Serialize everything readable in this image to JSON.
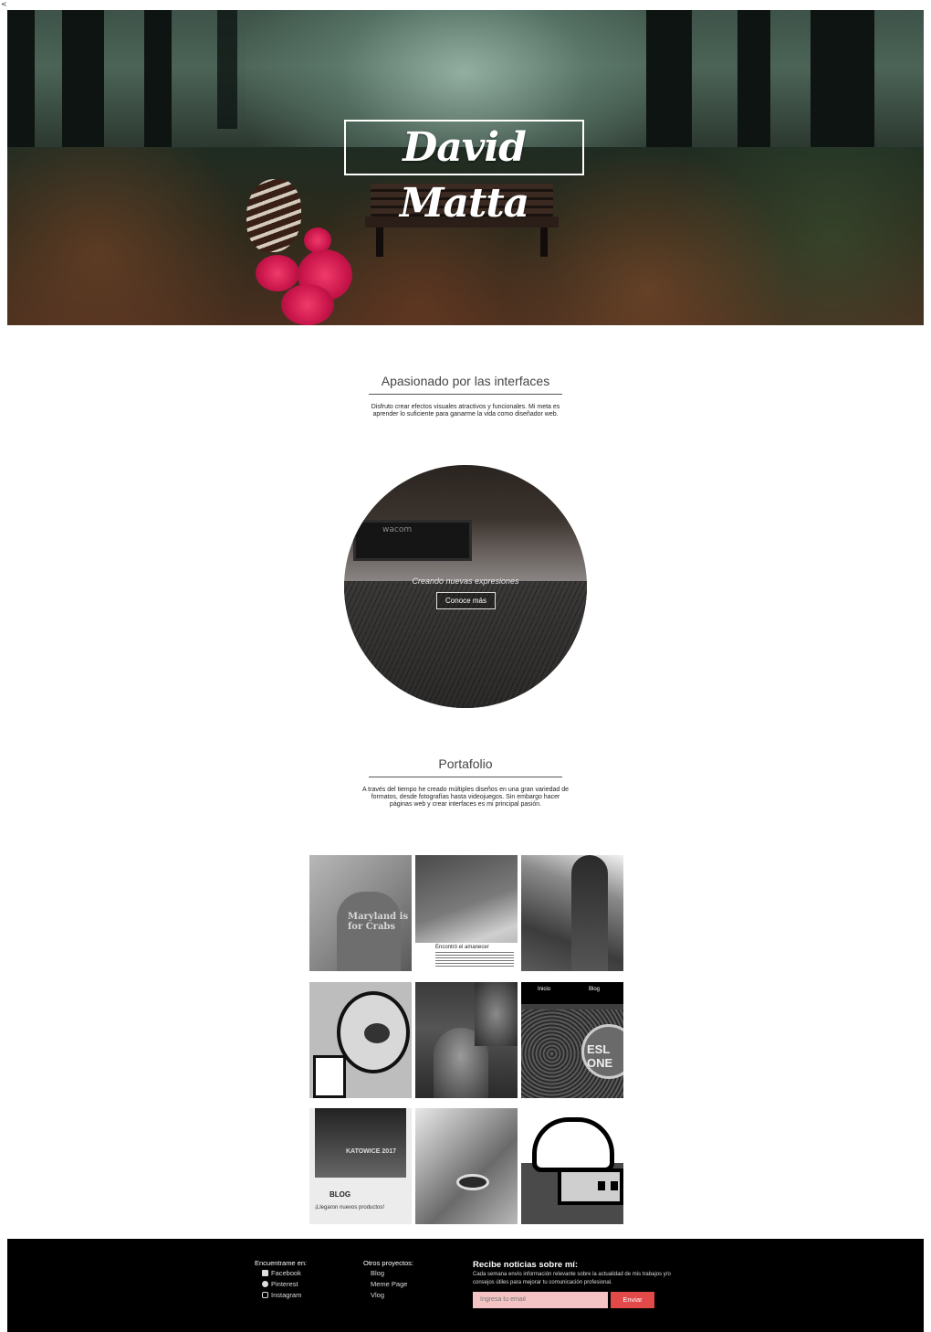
{
  "stray_char": "<",
  "hero": {
    "logo_text": "David Matta"
  },
  "about": {
    "title": "Apasionado por las interfaces",
    "body_line1": "Disfruto crear efectos visuales atractivos y funcionales. Mi meta es",
    "body_line2": "aprender lo suficiente para ganarme la vida como diseñador web."
  },
  "feature": {
    "brand": "wacom",
    "tagline": "Creando nuevas expresiones",
    "button_label": "Conoce más"
  },
  "portfolio": {
    "title": "Portafolio",
    "body_line1": "A través del tiempo he creado múltiples diseños en una gran variedad de",
    "body_line2": "formatos, desde fotografías hasta videojuegos. Sin embargo hacer",
    "body_line3": "páginas web y crear interfaces es mi principal pasión.",
    "tiles": [
      {
        "name": "maryland-photo",
        "caption": "Maryland is for Crabs"
      },
      {
        "name": "amanecer-post",
        "caption": "Encontró el amanecer"
      },
      {
        "name": "warrior-art",
        "caption": ""
      },
      {
        "name": "toaster-illustration",
        "caption": ""
      },
      {
        "name": "portrait-collage",
        "caption": ""
      },
      {
        "name": "esports-site",
        "caption": "",
        "nav": [
          "Inicio",
          "Blog"
        ],
        "banner": "ESL ONE"
      },
      {
        "name": "katowice-blog",
        "caption": "BLOG",
        "subcaption": "¡Llegaron nuevos productos!",
        "banner": "KATOWICE 2017"
      },
      {
        "name": "lowpoly-portrait",
        "caption": ""
      },
      {
        "name": "pixel-art",
        "caption": ""
      }
    ]
  },
  "footer": {
    "social_heading": "Encuentrame en:",
    "social_links": [
      "Facebook",
      "Pinterest",
      "Instagram"
    ],
    "projects_heading": "Otros proyectos:",
    "project_links": [
      "Blog",
      "Meme Page",
      "Vlog"
    ],
    "newsletter_title": "Recibe noticias sobre mí:",
    "newsletter_body": "Cada semana envío información relevante sobre la actualidad de mis trabajos y/o consejos útiles para mejorar tu comunicación profesional.",
    "email_placeholder": "Ingresa tu email",
    "send_label": "Enviar"
  },
  "colors": {
    "footer_bg": "#000000",
    "send_button": "#e24a4a",
    "input_bg": "#f4c4c4"
  }
}
